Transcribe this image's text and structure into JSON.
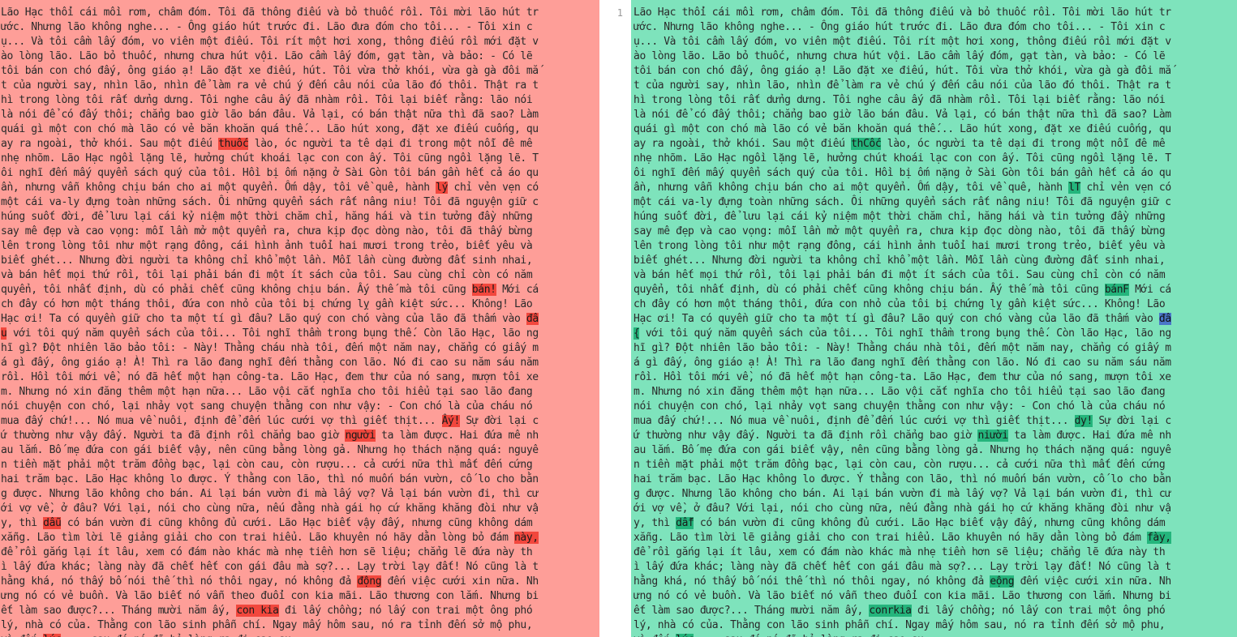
{
  "gutter": {
    "line_number": "1"
  },
  "left_lines": [
    [
      "Lão Hạc thổi cái mồi rơm, châm đóm. Tôi đã thông điếu và bỏ thuốc rồi. Tôi mời lão hút tr"
    ],
    [
      "ước. Nhưng lão không nghe... - Ông giáo hút trước đi. Lão đưa đóm cho tôi... - Tôi xin c"
    ],
    [
      "ụ... Và tôi cầm lấy đóm, vo viên một điếu. Tôi rít một hơi xong, thông điếu rồi mới đặt v"
    ],
    [
      "ào lòng lão. Lão bỏ thuốc, nhưng chưa hút vội. Lão cầm lấy đóm, gạt tàn, và bảo: - Có lẽ"
    ],
    [
      "tôi bán con chó đấy, ông giáo ạ! Lão đặt xe điếu, hút. Tôi vừa thở khói, vừa gà gà đôi mắ"
    ],
    [
      "t của người say, nhìn lão, nhìn để làm ra vẻ chú ý đến câu nói của lão đó thôi. Thật ra t"
    ],
    [
      "hì trong lòng tôi rất dửng dưng. Tôi nghe câu ấy đã nhàm rồi. Tôi lại biết rằng: lão nói"
    ],
    [
      "là nói để có đấy thôi; chẳng bao giờ lão bán đâu. Vả lại, có bán thật nữa thì đã sao? Làm"
    ],
    [
      "quái gì một con chó mà lão có vẻ băn khoăn quá thế... Lão hút xong, đặt xe điếu cuống, qu"
    ],
    [
      "ay ra ngoài, thở khói. Sau một điếu ",
      {
        "h": "thuốc"
      },
      " lào, óc người ta tê dại đi trong một nỗi đê mê"
    ],
    [
      "nhẹ nhõm. Lão Hạc ngồi lặng lẽ, hưởng chút khoái lạc con con ấy. Tôi cũng ngồi lặng lẽ. T"
    ],
    [
      "ôi nghĩ đến mấy quyển sách quý của tôi. Hồi bị ốm nặng ở Sài Gòn tôi bán gần hết cả áo qu"
    ],
    [
      "ần, nhưng vẫn không chịu bán cho ai một quyển. Ốm dậy, tôi về quê, hành ",
      {
        "h": "lý"
      },
      " chỉ vẻn vẹn có"
    ],
    [
      "một cái va-ly đựng toàn những sách. Ôi những quyển sách rất nâng niu! Tôi đã nguyện giữ c"
    ],
    [
      "húng suốt đời, để lưu lại cái kỷ niệm một thời chăm chỉ, hăng hái và tin tưởng đầy những"
    ],
    [
      "say mê đẹp và cao vọng: mỗi lần mở một quyển ra, chưa kịp đọc dòng nào, tôi đã thấy bừng"
    ],
    [
      "lên trong lòng tôi như một rạng đông, cái hình ảnh tuổi hai mươi trong trẻo, biết yêu và"
    ],
    [
      "biết ghét... Nhưng đời người ta không chỉ khổ một lần. Mỗi lần cùng đường đất sinh nhai,"
    ],
    [
      "và bán hết mọi thứ rồi, tôi lại phải bán đi một ít sách của tôi. Sau cùng chỉ còn có năm"
    ],
    [
      "quyển, tôi nhất định, dù có phải chết cũng không chịu bán. Ấy thế mà tôi cũng ",
      {
        "h": "bán!"
      },
      " Mới cá"
    ],
    [
      "ch đây có hơn một tháng thôi, đứa con nhỏ của tôi bị chứng lỵ gần kiệt sức... Không! Lão"
    ],
    [
      "Hạc ơi! Ta có quyền giữ cho ta một tí gì đâu? Lão quý con chó vàng của lão đã thấm vào ",
      {
        "h": "đâ"
      }
    ],
    [
      {
        "h": "u"
      },
      " với tôi quý năm quyển sách của tôi... Tôi nghĩ thầm trong bụng thế. Còn lão Hạc, lão ng"
    ],
    [
      "hĩ gì? Đột nhiên lão bảo tôi: - Này! Thằng cháu nhà tôi, đến một năm nay, chẳng có giấy m"
    ],
    [
      "á gì đấy, ông giáo ạ! À! Thì ra lão đang nghĩ đến thằng con lão. Nó đi cao su năm sáu năm"
    ],
    [
      "rồi. Hồi tôi mới về, nó đã hết một hạn công-ta. Lão Hạc, đem thư của nó sang, mượn tôi xe"
    ],
    [
      "m. Nhưng nó xin đăng thêm một hạn nữa... Lão vội cắt nghĩa cho tôi hiểu tại sao lão đang"
    ],
    [
      "nói chuyện con chó, lại nhảy vọt sang chuyện thằng con như vậy: - Con chó là của cháu nó"
    ],
    [
      "mua đấy chứ!... Nó mua về nuôi, định để đến lúc cưới vợ thì giết thịt... ",
      {
        "h": "Ấy!"
      },
      " Sự đời lại c"
    ],
    [
      "ứ thường như vậy đấy. Người ta đã định rồi chẳng bao giờ ",
      {
        "h": "người"
      },
      " ta làm được. Hai đứa mê nh"
    ],
    [
      "au lắm. Bố mẹ đứa con gái biết vậy, nên cũng bằng lòng gả. Nhưng họ thách nặng quá: nguyê"
    ],
    [
      "n tiền mặt phải một trăm đồng bạc, lại còn cau, còn rượu... cả cưới nữa thì mất đến cứng"
    ],
    [
      "hai trăm bạc. Lão Hạc không lo được. Ý thằng con lão, thì nó muốn bán vườn, cố lo cho bằn"
    ],
    [
      "g được. Nhưng lão không cho bán. Ai lại bán vườn đi mà lấy vợ? Vả lại bán vườn đi, thì cư"
    ],
    [
      "ới vợ về, ở đâu? Với lại, nói cho cùng nữa, nếu đằng nhà gái họ cứ khăng khăng đòi như vậ"
    ],
    [
      "y, thì ",
      {
        "h": "dẫu"
      },
      " có bán vườn đi cũng không đủ cưới. Lão Hạc biết vậy đấy, nhưng cũng không dám"
    ],
    [
      "xẵng. Lão tìm lời lẽ giảng giải cho con trai hiểu. Lão khuyên nó hãy dằn lòng bỏ đám ",
      {
        "h": "này,"
      }
    ],
    [
      "để rồi gắng lại ít lâu, xem có đám nào khác mà nhẹ tiền hơn sẽ liệu; chẳng lẽ đứa này th"
    ],
    [
      "ì lấy đứa khác; làng này đã chết hết con gái đâu mà sợ?... Lạy trời lạy đất! Nó cũng là t"
    ],
    [
      "hằng khá, nó thấy bố nói thế thì nó thôi ngay, nó không đả ",
      {
        "h": "động"
      },
      " đến việc cưới xin nữa. Nh"
    ],
    [
      "ưng nó có vẻ buồn. Và lão biết nó vẫn theo đuổi con kia mãi. Lão thương con lắm. Nhưng bi"
    ],
    [
      "ết làm sao được?... Tháng mười năm ấy, ",
      {
        "h": "con kia"
      },
      " đi lấy chồng; nó lấy con trai một ông phó"
    ],
    [
      "lý, nhà có của. Thằng con lão sinh phẫn chí. Ngay mấy hôm sau, nó ra tỉnh đến sở mộ phu,"
    ],
    [
      "vì đến ",
      {
        "h": "lúc"
      },
      " ... sau đó nó đã bỏ làng ra đi cao su..."
    ]
  ],
  "right_lines": [
    [
      "Lão Hạc thổi cái mồi rơm, châm đóm. Tôi đã thông điếu và bỏ thuốc rồi. Tôi mời lão hút tr"
    ],
    [
      "ước. Nhưng lão không nghe... - Ông giáo hút trước đi. Lão đưa đóm cho tôi... - Tôi xin c"
    ],
    [
      "ụ... Và tôi cầm lấy đóm, vo viên một điếu. Tôi rít một hơi xong, thông điếu rồi mới đặt v"
    ],
    [
      "ào lòng lão. Lão bỏ thuốc, nhưng chưa hút vội. Lão cầm lấy đóm, gạt tàn, và bảo: - Có lẽ"
    ],
    [
      "tôi bán con chó đấy, ông giáo ạ! Lão đặt xe điếu, hút. Tôi vừa thở khói, vừa gà gà đôi mắ"
    ],
    [
      "t của người say, nhìn lão, nhìn để làm ra vẻ chú ý đến câu nói của lão đó thôi. Thật ra t"
    ],
    [
      "hì trong lòng tôi rất dửng dưng. Tôi nghe câu ấy đã nhàm rồi. Tôi lại biết rằng: lão nói"
    ],
    [
      "là nói để có đấy thôi; chẳng bao giờ lão bán đâu. Vả lại, có bán thật nữa thì đã sao? Làm"
    ],
    [
      "quái gì một con chó mà lão có vẻ băn khoăn quá thế... Lão hút xong, đặt xe điếu cuống, qu"
    ],
    [
      "ay ra ngoài, thở khói. Sau một điếu ",
      {
        "h": "thCốc"
      },
      " lào, óc người ta tê dại đi trong một nỗi đê mê"
    ],
    [
      "nhẹ nhõm. Lão Hạc ngồi lặng lẽ, hưởng chút khoái lạc con con ấy. Tôi cũng ngồi lặng lẽ. T"
    ],
    [
      "ôi nghĩ đến mấy quyển sách quý của tôi. Hồi bị ốm nặng ở Sài Gòn tôi bán gần hết cả áo qu"
    ],
    [
      "ần, nhưng vẫn không chịu bán cho ai một quyển. Ốm dậy, tôi về quê, hành ",
      {
        "h": "lT"
      },
      " chỉ vẻn vẹn có"
    ],
    [
      "một cái va-ly đựng toàn những sách. Ôi những quyển sách rất nâng niu! Tôi đã nguyện giữ c"
    ],
    [
      "húng suốt đời, để lưu lại cái kỷ niệm một thời chăm chỉ, hăng hái và tin tưởng đầy những"
    ],
    [
      "say mê đẹp và cao vọng: mỗi lần mở một quyển ra, chưa kịp đọc dòng nào, tôi đã thấy bừng"
    ],
    [
      "lên trong lòng tôi như một rạng đông, cái hình ảnh tuổi hai mươi trong trẻo, biết yêu và"
    ],
    [
      "biết ghét... Nhưng đời người ta không chỉ khổ một lần. Mỗi lần cùng đường đất sinh nhai,"
    ],
    [
      "và bán hết mọi thứ rồi, tôi lại phải bán đi một ít sách của tôi. Sau cùng chỉ còn có năm"
    ],
    [
      "quyển, tôi nhất định, dù có phải chết cũng không chịu bán. Ấy thế mà tôi cũng ",
      {
        "h": "bánF"
      },
      " Mới cá"
    ],
    [
      "ch đây có hơn một tháng thôi, đứa con nhỏ của tôi bị chứng lỵ gần kiệt sức... Không! Lão"
    ],
    [
      "Hạc ơi! Ta có quyền giữ cho ta một tí gì đâu? Lão quý con chó vàng của lão đã thấm vào ",
      {
        "h": "đâ",
        "c": "mod"
      }
    ],
    [
      {
        "h": "{"
      },
      " với tôi quý năm quyển sách của tôi... Tôi nghĩ thầm trong bụng thế. Còn lão Hạc, lão ng"
    ],
    [
      "hĩ gì? Đột nhiên lão bảo tôi: - Này! Thằng cháu nhà tôi, đến một năm nay, chẳng có giấy m"
    ],
    [
      "á gì đấy, ông giáo ạ! À! Thì ra lão đang nghĩ đến thằng con lão. Nó đi cao su năm sáu năm"
    ],
    [
      "rồi. Hồi tôi mới về, nó đã hết một hạn công-ta. Lão Hạc, đem thư của nó sang, mượn tôi xe"
    ],
    [
      "m. Nhưng nó xin đăng thêm một hạn nữa... Lão vội cắt nghĩa cho tôi hiểu tại sao lão đang"
    ],
    [
      "nói chuyện con chó, lại nhảy vọt sang chuyện thằng con như vậy: - Con chó là của cháu nó"
    ],
    [
      "mua đấy chứ!... Nó mua về nuôi, định để đến lúc cưới vợ thì giết thịt... ",
      {
        "h": "dy!"
      },
      " Sự đời lại c"
    ],
    [
      "ứ thường như vậy đấy. Người ta đã định rồi chẳng bao giờ ",
      {
        "h": "niười"
      },
      " ta làm được. Hai đứa mê nh"
    ],
    [
      "au lắm. Bố mẹ đứa con gái biết vậy, nên cũng bằng lòng gả. Nhưng họ thách nặng quá: nguyê"
    ],
    [
      "n tiền mặt phải một trăm đồng bạc, lại còn cau, còn rượu... cả cưới nữa thì mất đến cứng"
    ],
    [
      "hai trăm bạc. Lão Hạc không lo được. Ý thằng con lão, thì nó muốn bán vườn, cố lo cho bằn"
    ],
    [
      "g được. Nhưng lão không cho bán. Ai lại bán vườn đi mà lấy vợ? Vả lại bán vườn đi, thì cư"
    ],
    [
      "ới vợ về, ở đâu? Với lại, nói cho cùng nữa, nếu đằng nhà gái họ cứ khăng khăng đòi như vậ"
    ],
    [
      "y, thì ",
      {
        "h": "dẫf"
      },
      " có bán vườn đi cũng không đủ cưới. Lão Hạc biết vậy đấy, nhưng cũng không dám"
    ],
    [
      "xẵng. Lão tìm lời lẽ giảng giải cho con trai hiểu. Lão khuyên nó hãy dằn lòng bỏ đám ",
      {
        "h": "fày,"
      }
    ],
    [
      "để rồi gắng lại ít lâu, xem có đám nào khác mà nhẹ tiền hơn sẽ liệu; chẳng lẽ đứa này th"
    ],
    [
      "ì lấy đứa khác; làng này đã chết hết con gái đâu mà sợ?... Lạy trời lạy đất! Nó cũng là t"
    ],
    [
      "hằng khá, nó thấy bố nói thế thì nó thôi ngay, nó không đả ",
      {
        "h": "eộng"
      },
      " đến việc cưới xin nữa. Nh"
    ],
    [
      "ưng nó có vẻ buồn. Và lão biết nó vẫn theo đuổi con kia mãi. Lão thương con lắm. Nhưng bi"
    ],
    [
      "ết làm sao được?... Tháng mười năm ấy, ",
      {
        "h": "conrkia"
      },
      " đi lấy chồng; nó lấy con trai một ông phó"
    ],
    [
      "lý, nhà có của. Thằng con lão sinh phẫn chí. Ngay mấy hôm sau, nó ra tỉnh đến sở mộ phu,"
    ],
    [
      "vì đến ",
      {
        "h": "lúc"
      },
      " ... sau đó nó đã bỏ làng ra đi cao su..."
    ]
  ]
}
